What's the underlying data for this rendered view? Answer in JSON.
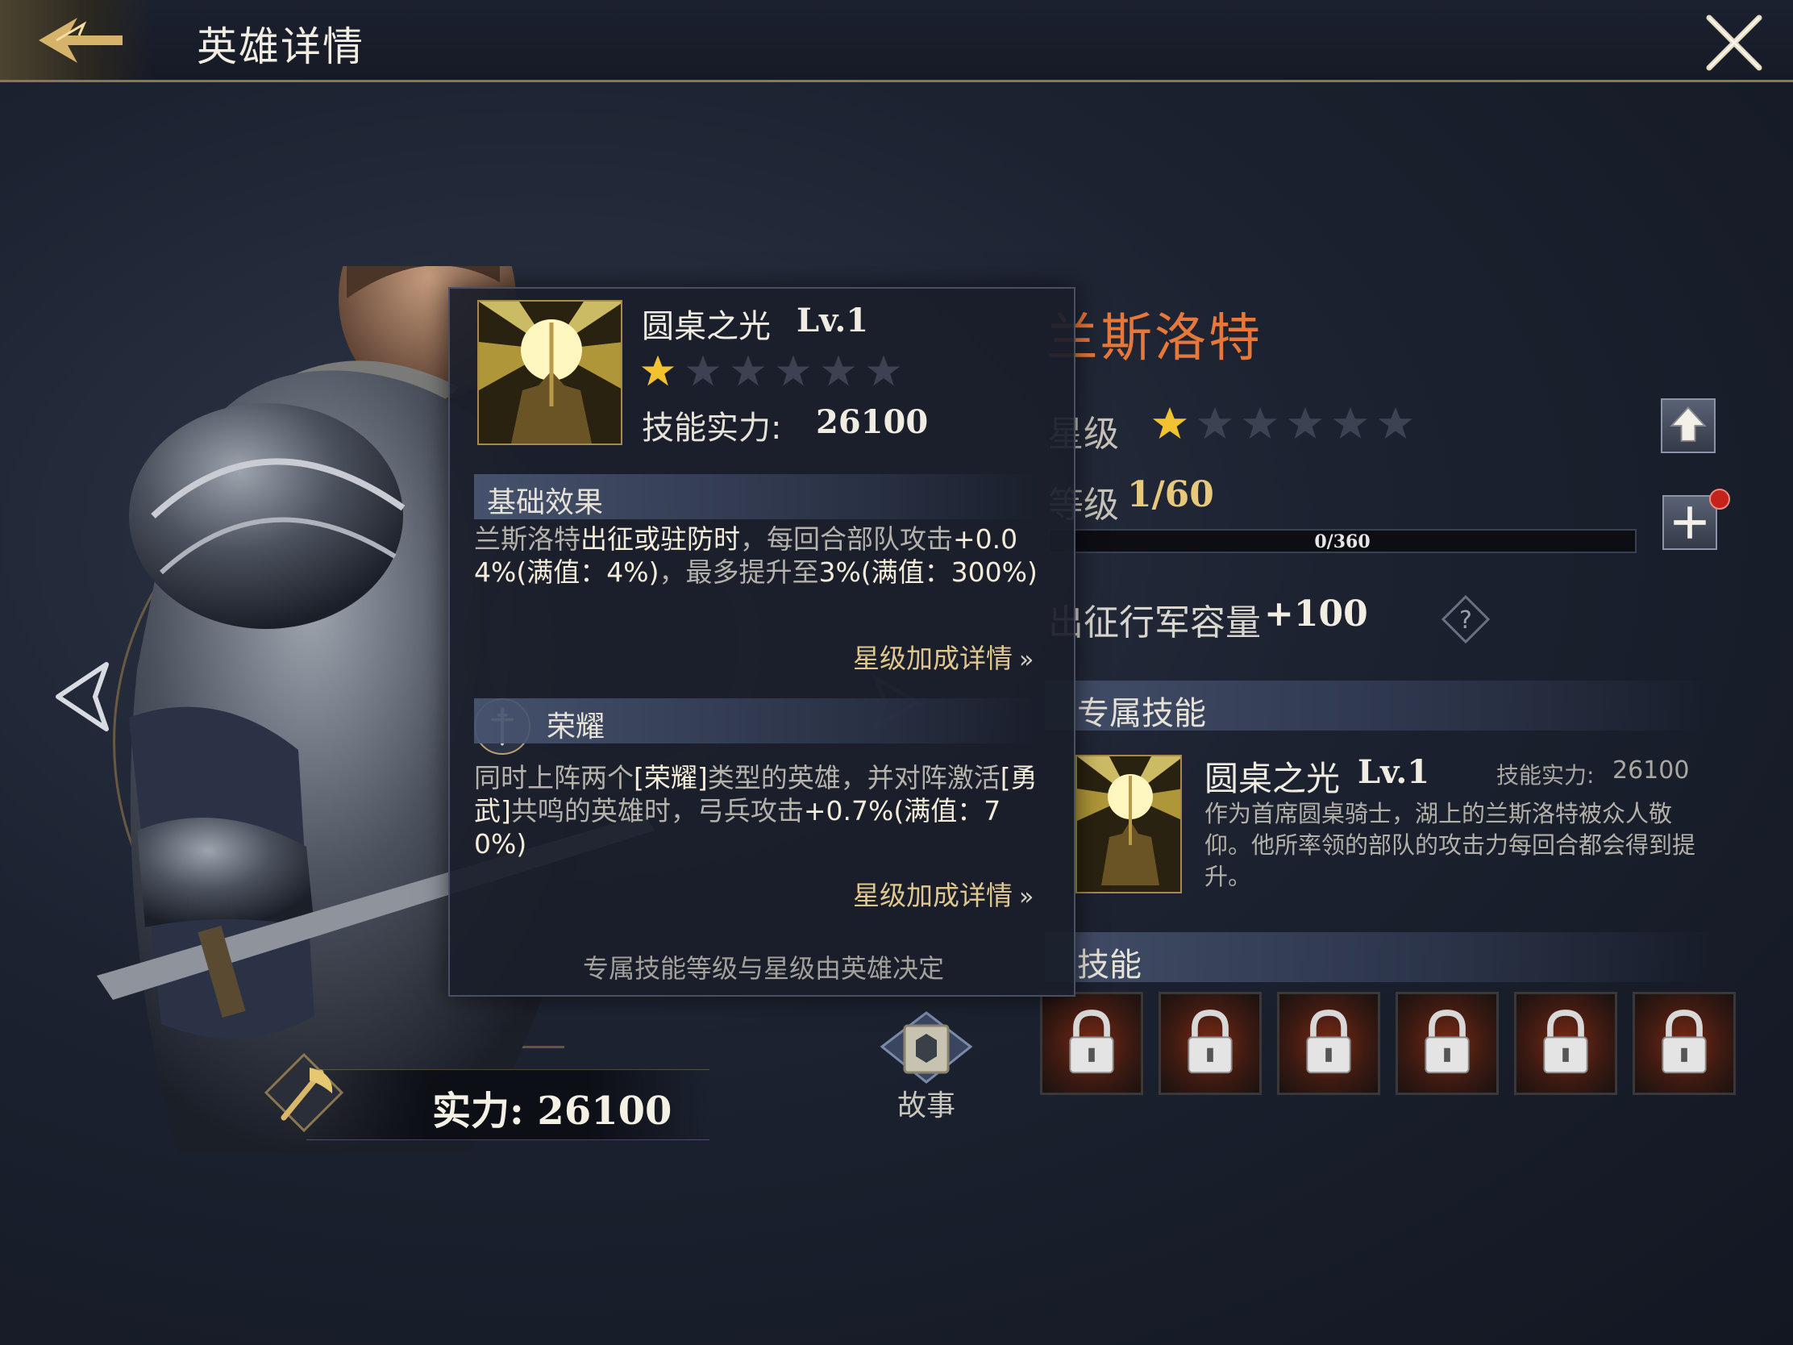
{
  "header": {
    "title": "英雄详情"
  },
  "hero": {
    "name": "兰斯洛特",
    "star_label": "星级",
    "stars_total": 6,
    "stars_filled": 1,
    "level_label": "等级",
    "level_value": "1/60",
    "xp_text": "0/360",
    "xp_fraction": 0,
    "capacity_label": "出征行军容量",
    "capacity_value": "+100",
    "power_text": "实力: 26100",
    "story_label": "故事"
  },
  "exclusive": {
    "header": "专属技能",
    "skill_name": "圆桌之光",
    "skill_level": "Lv.1",
    "power_label": "技能实力:",
    "power_value": "26100",
    "description": "作为首席圆桌骑士，湖上的兰斯洛特被众人敬仰。他所率领的部队的攻击力每回合都会得到提升。"
  },
  "skills": {
    "header": "技能",
    "slots": 6
  },
  "popup": {
    "skill_name": "圆桌之光",
    "skill_level": "Lv.1",
    "stars_total": 6,
    "stars_filled": 1,
    "power_label": "技能实力:",
    "power_value": "26100",
    "base_header": "基础效果",
    "base_text": {
      "p1": "兰斯洛特",
      "p2": "出征或驻防时",
      "p3": "，每回合部队攻击",
      "p4": "+0.04%(满值：4%)",
      "p5": "，最多提升至",
      "p6": "3%(满值：300%)"
    },
    "star_link": "星级加成详情",
    "glory_header": "荣耀",
    "glory_text": {
      "p1": "同时上阵两个",
      "p2": "[荣耀]",
      "p3": "类型的英雄，并对阵激活",
      "p4": "[勇武]",
      "p5": "共鸣的英雄时，弓兵攻击",
      "p6": "+0.7%(满值：70%)"
    },
    "footer": "专属技能等级与星级由英雄决定"
  },
  "colors": {
    "accent_orange": "#e8783a",
    "gold": "#e0c78e",
    "star_gold": "#f2c230",
    "star_dim": "#3d4252",
    "badge_red": "#c6221c"
  }
}
